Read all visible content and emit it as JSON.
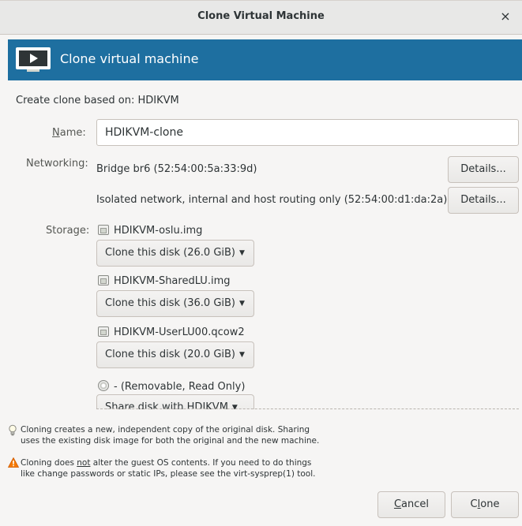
{
  "window": {
    "title": "Clone Virtual Machine",
    "close_icon": "×"
  },
  "banner": {
    "title": "Clone virtual machine",
    "icon": "vm-monitor-icon",
    "color": "#1e6fa0"
  },
  "clone_based_on": "Create clone based on: HDIKVM",
  "name": {
    "label_mnemonic": "N",
    "label_rest": "ame:",
    "value": "HDIKVM-clone"
  },
  "networking": {
    "label": "Networking:",
    "interfaces": [
      {
        "text": "Bridge br6 (52:54:00:5a:33:9d)",
        "button": "Details..."
      },
      {
        "text": "Isolated network, internal and host routing only (52:54:00:d1:da:2a)",
        "button": "Details..."
      }
    ]
  },
  "storage": {
    "label": "Storage:",
    "disks": [
      {
        "icon": "disk-icon",
        "name": "HDIKVM-oslu.img",
        "action": "Clone this disk (26.0 GiB)"
      },
      {
        "icon": "disk-icon",
        "name": "HDIKVM-SharedLU.img",
        "action": "Clone this disk (36.0 GiB)"
      },
      {
        "icon": "disk-icon",
        "name": "HDIKVM-UserLU00.qcow2",
        "action": "Clone this disk (20.0 GiB)"
      },
      {
        "icon": "cdrom-icon",
        "name": "- (Removable, Read Only)",
        "action": "Share disk with HDIKVM"
      }
    ]
  },
  "notes": {
    "info_line1": "Cloning creates a new, independent copy of the original disk. Sharing",
    "info_line2": "uses the existing disk image for both the original and the new machine.",
    "warn_pre": "Cloning does ",
    "warn_not": "not",
    "warn_post": " alter the guest OS contents. If you need to do things",
    "warn_line2": "like change passwords or static IPs, please see the virt-sysprep(1) tool."
  },
  "buttons": {
    "cancel_mnemonic": "C",
    "cancel_rest": "ancel",
    "clone_pre": "C",
    "clone_mnemonic": "l",
    "clone_rest": "one"
  }
}
